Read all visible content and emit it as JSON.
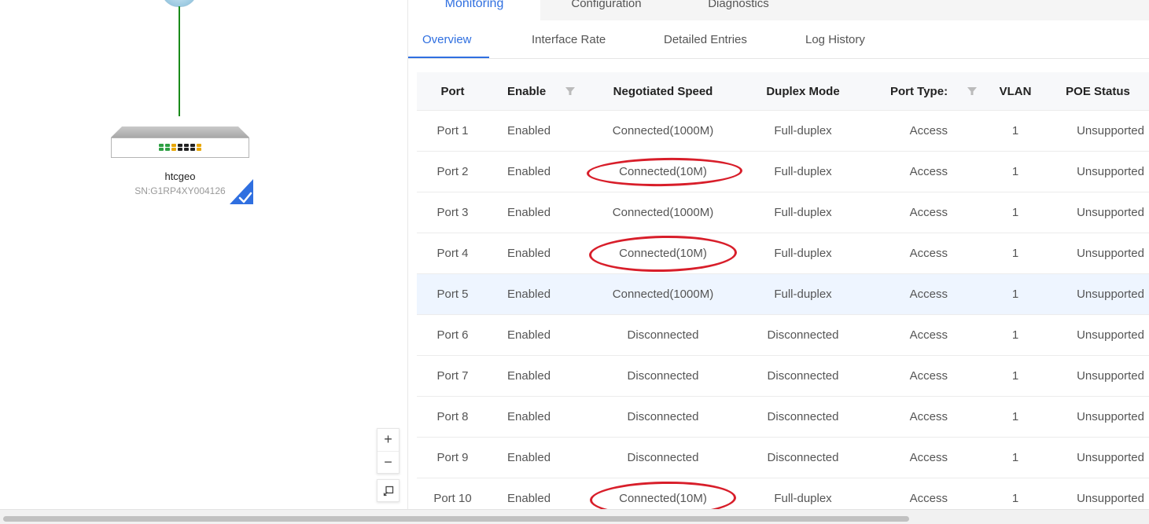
{
  "device": {
    "name": "htcgeo",
    "serial": "SN:G1RP4XY004126",
    "port_led_colors": [
      "#2ea043",
      "#2ea043",
      "#e8a600",
      "#222222",
      "#222222",
      "#222222",
      "#e8a600",
      "#2ea043",
      "#2ea043",
      "#e8a600",
      "#222222",
      "#222222",
      "#222222",
      "#e8a600"
    ]
  },
  "zoom": {
    "in_label": "+",
    "out_label": "−"
  },
  "top_tabs": [
    {
      "label": "Monitoring",
      "active": true
    },
    {
      "label": "Configuration",
      "active": false
    },
    {
      "label": "Diagnostics",
      "active": false
    }
  ],
  "sub_tabs": [
    {
      "label": "Overview",
      "active": true
    },
    {
      "label": "Interface Rate",
      "active": false
    },
    {
      "label": "Detailed Entries",
      "active": false
    },
    {
      "label": "Log History",
      "active": false
    }
  ],
  "table": {
    "columns": [
      "Port",
      "Enable",
      "Negotiated Speed",
      "Duplex Mode",
      "Port Type:",
      "VLAN",
      "POE Status"
    ],
    "rows": [
      [
        "Port 1",
        "Enabled",
        "Connected(1000M)",
        "Full-duplex",
        "Access",
        "1",
        "Unsupported"
      ],
      [
        "Port 2",
        "Enabled",
        "Connected(10M)",
        "Full-duplex",
        "Access",
        "1",
        "Unsupported"
      ],
      [
        "Port 3",
        "Enabled",
        "Connected(1000M)",
        "Full-duplex",
        "Access",
        "1",
        "Unsupported"
      ],
      [
        "Port 4",
        "Enabled",
        "Connected(10M)",
        "Full-duplex",
        "Access",
        "1",
        "Unsupported"
      ],
      [
        "Port 5",
        "Enabled",
        "Connected(1000M)",
        "Full-duplex",
        "Access",
        "1",
        "Unsupported"
      ],
      [
        "Port 6",
        "Enabled",
        "Disconnected",
        "Disconnected",
        "Access",
        "1",
        "Unsupported"
      ],
      [
        "Port 7",
        "Enabled",
        "Disconnected",
        "Disconnected",
        "Access",
        "1",
        "Unsupported"
      ],
      [
        "Port 8",
        "Enabled",
        "Disconnected",
        "Disconnected",
        "Access",
        "1",
        "Unsupported"
      ],
      [
        "Port 9",
        "Enabled",
        "Disconnected",
        "Disconnected",
        "Access",
        "1",
        "Unsupported"
      ],
      [
        "Port 10",
        "Enabled",
        "Connected(10M)",
        "Full-duplex",
        "Access",
        "1",
        "Unsupported"
      ]
    ],
    "highlighted_row": 4,
    "annotated_rows": [
      1,
      3,
      9
    ],
    "annotation_color": "#d81e2a"
  },
  "accent_color": "#2f6fe0",
  "link_color": "#1a8a1a"
}
